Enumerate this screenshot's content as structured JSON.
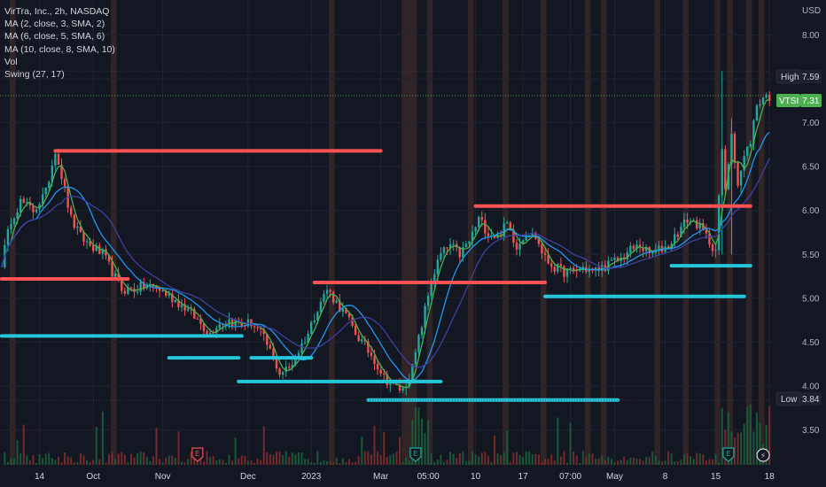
{
  "legend": {
    "title": "VirTra, Inc., 2h, NASDAQ",
    "indicators": [
      "MA (2, close, 3, SMA, 2)",
      "MA (6, close, 5, SMA, 6)",
      "MA (10, close, 8, SMA, 10)",
      "Vol",
      "Swing (27, 17)"
    ]
  },
  "badges": {
    "high_label": "High",
    "high_value": "7.59",
    "ticker_label": "VTSI",
    "ticker_value": "7.31",
    "low_label": "Low",
    "low_value": "3.84"
  },
  "colors": {
    "background": "#131722",
    "up": "#26a69a",
    "down": "#ef5350",
    "swing_high": "#ff5252",
    "swing_low": "#26c6da",
    "ma_fast": "#4caf50",
    "ma_mid": "#2196f3",
    "ma_slow": "#3f3fa0",
    "session_band": "#4a2f2a"
  },
  "event_markers": [
    {
      "icon": "earnings-icon",
      "glyph": "E",
      "x_index": 62,
      "color": "#ef5350"
    },
    {
      "icon": "earnings-icon",
      "glyph": "E",
      "x_index": 131,
      "color": "#26a69a"
    },
    {
      "icon": "earnings-icon",
      "glyph": "E",
      "x_index": 230,
      "color": "#26a69a"
    },
    {
      "icon": "lightning-icon",
      "glyph": "⚡",
      "x_index": 241,
      "color": "#d1d4dc"
    }
  ],
  "chart_data": {
    "type": "candlestick",
    "title": "VirTra, Inc., 2h, NASDAQ",
    "currency": "USD",
    "y_range": [
      3.1,
      8.4
    ],
    "y_ticks": [
      "8.00",
      "7.50",
      "7.00",
      "6.50",
      "6.00",
      "5.50",
      "5.00",
      "4.50",
      "4.00",
      "3.50"
    ],
    "x_count": 244,
    "x_ticks": [
      {
        "label": "14",
        "index": 12
      },
      {
        "label": "Oct",
        "index": 29
      },
      {
        "label": "Nov",
        "index": 51
      },
      {
        "label": "Dec",
        "index": 78
      },
      {
        "label": "2023",
        "index": 98
      },
      {
        "label": "Mar",
        "index": 120
      },
      {
        "label": "05:00",
        "index": 135
      },
      {
        "label": "10",
        "index": 150
      },
      {
        "label": "17",
        "index": 165
      },
      {
        "label": "07:00",
        "index": 180
      },
      {
        "label": "May",
        "index": 194
      },
      {
        "label": "8",
        "index": 210
      },
      {
        "label": "15",
        "index": 226
      },
      {
        "label": "18",
        "index": 243
      }
    ],
    "close_path": [
      [
        0,
        5.4
      ],
      [
        3,
        5.9
      ],
      [
        6,
        6.1
      ],
      [
        10,
        6.0
      ],
      [
        14,
        6.2
      ],
      [
        17,
        6.7
      ],
      [
        19,
        6.4
      ],
      [
        22,
        5.9
      ],
      [
        25,
        5.7
      ],
      [
        28,
        5.6
      ],
      [
        32,
        5.5
      ],
      [
        35,
        5.3
      ],
      [
        38,
        5.1
      ],
      [
        42,
        5.1
      ],
      [
        46,
        5.15
      ],
      [
        50,
        5.1
      ],
      [
        54,
        5.0
      ],
      [
        58,
        4.9
      ],
      [
        62,
        4.75
      ],
      [
        66,
        4.6
      ],
      [
        68,
        4.7
      ],
      [
        72,
        4.75
      ],
      [
        76,
        4.7
      ],
      [
        79,
        4.72
      ],
      [
        82,
        4.6
      ],
      [
        85,
        4.4
      ],
      [
        88,
        4.15
      ],
      [
        91,
        4.2
      ],
      [
        94,
        4.4
      ],
      [
        97,
        4.6
      ],
      [
        100,
        4.9
      ],
      [
        103,
        5.1
      ],
      [
        106,
        4.95
      ],
      [
        109,
        4.8
      ],
      [
        112,
        4.6
      ],
      [
        115,
        4.45
      ],
      [
        118,
        4.3
      ],
      [
        121,
        4.1
      ],
      [
        124,
        4.0
      ],
      [
        127,
        3.95
      ],
      [
        130,
        4.2
      ],
      [
        133,
        4.7
      ],
      [
        136,
        5.2
      ],
      [
        139,
        5.5
      ],
      [
        142,
        5.6
      ],
      [
        145,
        5.5
      ],
      [
        148,
        5.65
      ],
      [
        151,
        5.9
      ],
      [
        154,
        5.75
      ],
      [
        157,
        5.7
      ],
      [
        160,
        5.85
      ],
      [
        163,
        5.6
      ],
      [
        166,
        5.75
      ],
      [
        169,
        5.7
      ],
      [
        172,
        5.45
      ],
      [
        175,
        5.35
      ],
      [
        178,
        5.3
      ],
      [
        181,
        5.3
      ],
      [
        184,
        5.35
      ],
      [
        187,
        5.3
      ],
      [
        190,
        5.35
      ],
      [
        193,
        5.4
      ],
      [
        196,
        5.45
      ],
      [
        199,
        5.55
      ],
      [
        202,
        5.6
      ],
      [
        205,
        5.5
      ],
      [
        208,
        5.55
      ],
      [
        211,
        5.6
      ],
      [
        214,
        5.75
      ],
      [
        217,
        5.9
      ],
      [
        220,
        5.85
      ],
      [
        223,
        5.7
      ],
      [
        226,
        5.55
      ],
      [
        228,
        6.7
      ],
      [
        229,
        6.2
      ],
      [
        231,
        6.9
      ],
      [
        233,
        6.3
      ],
      [
        235,
        6.6
      ],
      [
        237,
        6.8
      ],
      [
        239,
        7.2
      ],
      [
        241,
        7.3
      ]
    ],
    "sessions": [
      {
        "from": 3,
        "to": 4
      },
      {
        "from": 35,
        "to": 36
      },
      {
        "from": 104,
        "to": 105
      },
      {
        "from": 127,
        "to": 131
      },
      {
        "from": 135,
        "to": 136
      },
      {
        "from": 148,
        "to": 149
      },
      {
        "from": 159,
        "to": 160
      },
      {
        "from": 171,
        "to": 172
      },
      {
        "from": 185,
        "to": 186
      },
      {
        "from": 190,
        "to": 191
      },
      {
        "from": 207,
        "to": 208
      },
      {
        "from": 216,
        "to": 217
      },
      {
        "from": 226,
        "to": 227
      },
      {
        "from": 230,
        "to": 231
      },
      {
        "from": 236,
        "to": 237
      },
      {
        "from": 240,
        "to": 241
      }
    ],
    "swing_levels": [
      {
        "kind": "high",
        "value": 6.68,
        "from": 17,
        "to": 120
      },
      {
        "kind": "high",
        "value": 5.22,
        "from": 0,
        "to": 40
      },
      {
        "kind": "high",
        "value": 5.18,
        "from": 99,
        "to": 172
      },
      {
        "kind": "high",
        "value": 6.05,
        "from": 150,
        "to": 237
      },
      {
        "kind": "low",
        "value": 4.57,
        "from": 0,
        "to": 76
      },
      {
        "kind": "low",
        "value": 4.32,
        "from": 53,
        "to": 75
      },
      {
        "kind": "low",
        "value": 4.32,
        "from": 79,
        "to": 98
      },
      {
        "kind": "low",
        "value": 4.05,
        "from": 75,
        "to": 139
      },
      {
        "kind": "low",
        "value": 3.84,
        "from": 116,
        "to": 195
      },
      {
        "kind": "low",
        "value": 5.02,
        "from": 172,
        "to": 235
      },
      {
        "kind": "low",
        "value": 5.37,
        "from": 212,
        "to": 237
      }
    ],
    "reference_lines": [
      {
        "name": "High",
        "value": 7.59
      },
      {
        "name": "VTSI",
        "value": 7.31
      },
      {
        "name": "Low",
        "value": 3.84
      }
    ],
    "ma_periods": [
      2,
      6,
      10
    ]
  }
}
